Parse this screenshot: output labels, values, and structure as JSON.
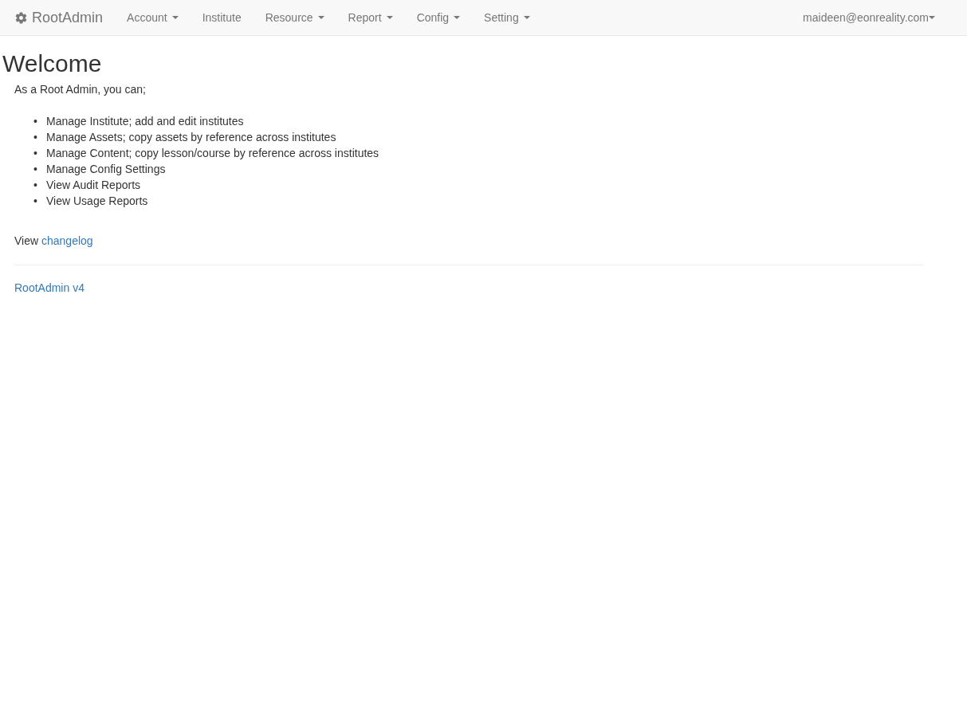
{
  "navbar": {
    "brand": "RootAdmin",
    "items": [
      {
        "label": "Account",
        "kind": "dropdown"
      },
      {
        "label": "Institute",
        "kind": "link"
      },
      {
        "label": "Resource",
        "kind": "dropdown"
      },
      {
        "label": "Report",
        "kind": "dropdown"
      },
      {
        "label": "Config",
        "kind": "dropdown"
      },
      {
        "label": "Setting",
        "kind": "dropdown"
      }
    ],
    "user": {
      "label": "maideen@eonreality.com",
      "kind": "dropdown"
    }
  },
  "heading": "Welcome",
  "intro": "As a Root Admin, you can;",
  "abilities": [
    {
      "bullet": "•",
      "text": "Manage Institute; add and edit institutes"
    },
    {
      "bullet": "•",
      "text": "Manage Assets; copy assets by reference across institutes"
    },
    {
      "bullet": "•",
      "text": "Manage Content; copy lesson/course by reference across institutes"
    },
    {
      "bullet": "•",
      "text": "Manage Config Settings"
    },
    {
      "bullet": "•",
      "text": "View Audit Reports"
    },
    {
      "bullet": "•",
      "text": "View Usage Reports"
    }
  ],
  "changelog": {
    "prefix": "View",
    "link": "changelog"
  },
  "footer_link": "RootAdmin v4"
}
